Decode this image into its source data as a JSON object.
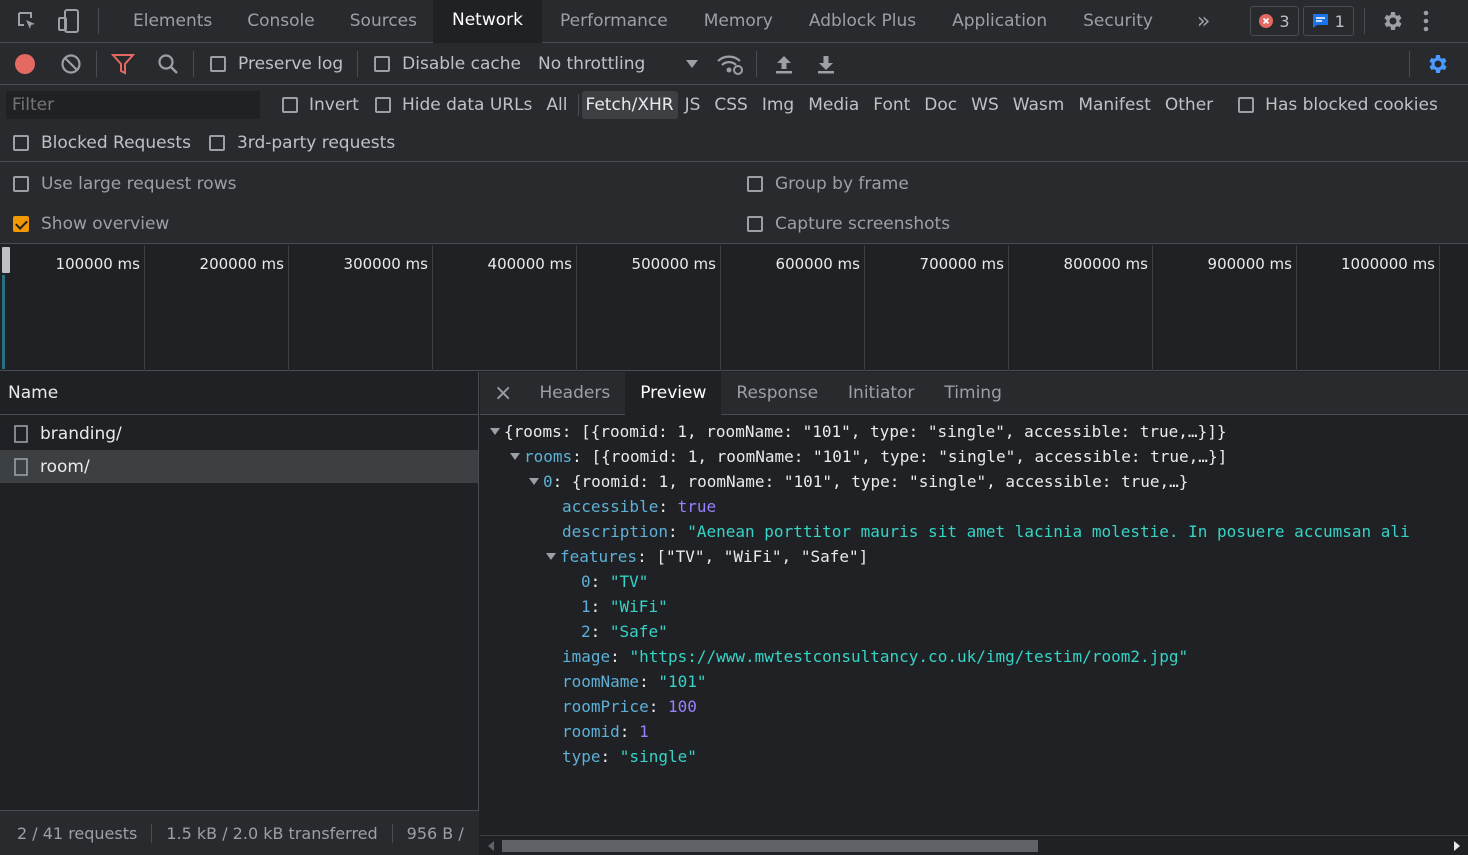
{
  "tabbar": {
    "tabs": [
      "Elements",
      "Console",
      "Sources",
      "Network",
      "Performance",
      "Memory",
      "Adblock Plus",
      "Application",
      "Security"
    ],
    "active": "Network",
    "more": "»",
    "errors_count": "3",
    "messages_count": "1"
  },
  "toolbar": {
    "preserve_log": "Preserve log",
    "disable_cache": "Disable cache",
    "throttling": "No throttling"
  },
  "filterbar": {
    "placeholder": "Filter",
    "invert": "Invert",
    "hide_data_urls": "Hide data URLs",
    "types": [
      "All",
      "Fetch/XHR",
      "JS",
      "CSS",
      "Img",
      "Media",
      "Font",
      "Doc",
      "WS",
      "Wasm",
      "Manifest",
      "Other"
    ],
    "active_type": "Fetch/XHR",
    "has_blocked_cookies": "Has blocked cookies",
    "blocked_requests": "Blocked Requests",
    "third_party": "3rd-party requests"
  },
  "settings": {
    "large_rows": "Use large request rows",
    "group_by_frame": "Group by frame",
    "show_overview": "Show overview",
    "capture_screenshots": "Capture screenshots",
    "show_overview_checked": true
  },
  "overview": {
    "ticks": [
      "100000 ms",
      "200000 ms",
      "300000 ms",
      "400000 ms",
      "500000 ms",
      "600000 ms",
      "700000 ms",
      "800000 ms",
      "900000 ms",
      "1000000 ms"
    ]
  },
  "requests": {
    "header": "Name",
    "items": [
      "branding/",
      "room/"
    ],
    "selected": "room/"
  },
  "status": {
    "requests": "2 / 41 requests",
    "transferred": "1.5 kB / 2.0 kB transferred",
    "resources": "956 B /"
  },
  "detail": {
    "close": "×",
    "tabs": [
      "Headers",
      "Preview",
      "Response",
      "Initiator",
      "Timing"
    ],
    "active": "Preview"
  },
  "preview": {
    "root_summary": "{rooms: [{roomid: 1, roomName: \"101\", type: \"single\", accessible: true,…}]}",
    "rooms_key": "rooms",
    "rooms_summary": "[{roomid: 1, roomName: \"101\", type: \"single\", accessible: true,…}]",
    "item_index": "0",
    "item_summary": "{roomid: 1, roomName: \"101\", type: \"single\", accessible: true,…}",
    "accessible": "true",
    "description": "\"Aenean porttitor mauris sit amet lacinia molestie. In posuere accumsan ali",
    "features_summary": "[\"TV\", \"WiFi\", \"Safe\"]",
    "features": [
      "\"TV\"",
      "\"WiFi\"",
      "\"Safe\""
    ],
    "image": "\"https://www.mwtestconsultancy.co.uk/img/testim/room2.jpg\"",
    "roomName": "\"101\"",
    "roomPrice": "100",
    "roomid": "1",
    "type": "\"single\""
  },
  "colors": {
    "accent_orange": "#f29900",
    "record_red": "#f28b82",
    "key_blue": "#5db0d7",
    "string_teal": "#35d4c7",
    "number_purple": "#9980ff"
  }
}
